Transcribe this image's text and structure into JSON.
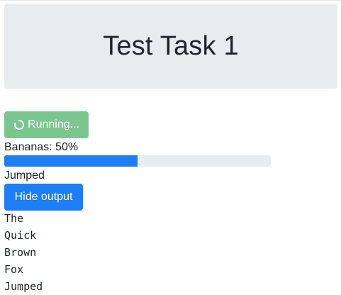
{
  "header": {
    "title": "Test Task 1"
  },
  "task": {
    "button_label": "Running...",
    "button_icon": "spinner-icon",
    "progress_label": "Bananas: 50%",
    "progress_fraction": 0.5,
    "status": "Jumped",
    "toggle_output_label": "Hide output"
  },
  "output_lines": [
    "The",
    "Quick",
    "Brown",
    "Fox",
    "Jumped"
  ],
  "colors": {
    "running_button": "#7ac68f",
    "primary": "#1e7ef5",
    "hero_bg": "#e9ecef"
  }
}
